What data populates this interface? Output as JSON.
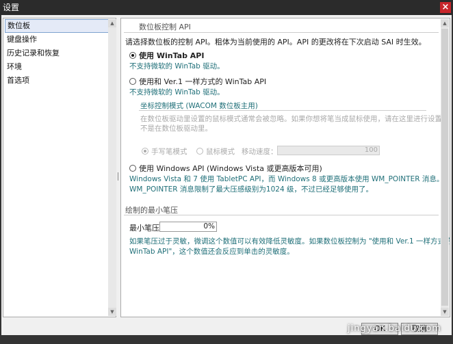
{
  "window": {
    "title": "设置",
    "close": "×"
  },
  "sidebar": {
    "items": [
      {
        "label": "数位板"
      },
      {
        "label": "键盘操作"
      },
      {
        "label": "历史记录和恢复"
      },
      {
        "label": "环境"
      },
      {
        "label": "首选项"
      }
    ]
  },
  "tablet": {
    "header": "数位板控制 API",
    "intro": "请选择数位板的控制 API。粗体为当前使用的 API。API 的更改将在下次启动 SAI 时生效。",
    "opt1": {
      "label": "使用 WinTab API",
      "note": "不支持微软的 WinTab 驱动。"
    },
    "opt2": {
      "label": "使用和 Ver.1 一样方式的 WinTab API",
      "note": "不支持微软的 WinTab 驱动。"
    },
    "coord": {
      "header": "坐标控制模式 (WACOM 数位板主用)",
      "desc1": "在数位板驱动里设置的鼠标模式通常会被忽略。如果你想将笔当成鼠标使用，请在这里进行设置，而",
      "desc2": "不是在数位板驱动里。",
      "pen": "手写笔模式",
      "mouse": "鼠标模式",
      "speed_label": "移动速度：",
      "speed_value": "100"
    },
    "opt3": {
      "label": "使用 Windows API (Windows Vista 或更高版本可用)",
      "note1": "Windows Vista 和 7 使用 TabletPC API，而 Windows 8 或更高版本使用 WM_POINTER 消息。",
      "note2": "WM_POINTER 消息限制了最大压感级别为1024 级，不过已经足够使用了。"
    }
  },
  "pressure": {
    "header": "绘制的最小笔压",
    "label": "最小笔压：",
    "value": "0%",
    "desc1": "如果笔压过于灵敏，微调这个数值可以有效降低灵敏度。如果数位板控制为 \"使用和 Ver.1 一样方式的",
    "desc2": "WinTab API\"，这个数值还会反应到单击的灵敏度。"
  },
  "buttons": {
    "ok": "OK",
    "cancel": "取消"
  },
  "watermark": "jingyan.baidu.com"
}
